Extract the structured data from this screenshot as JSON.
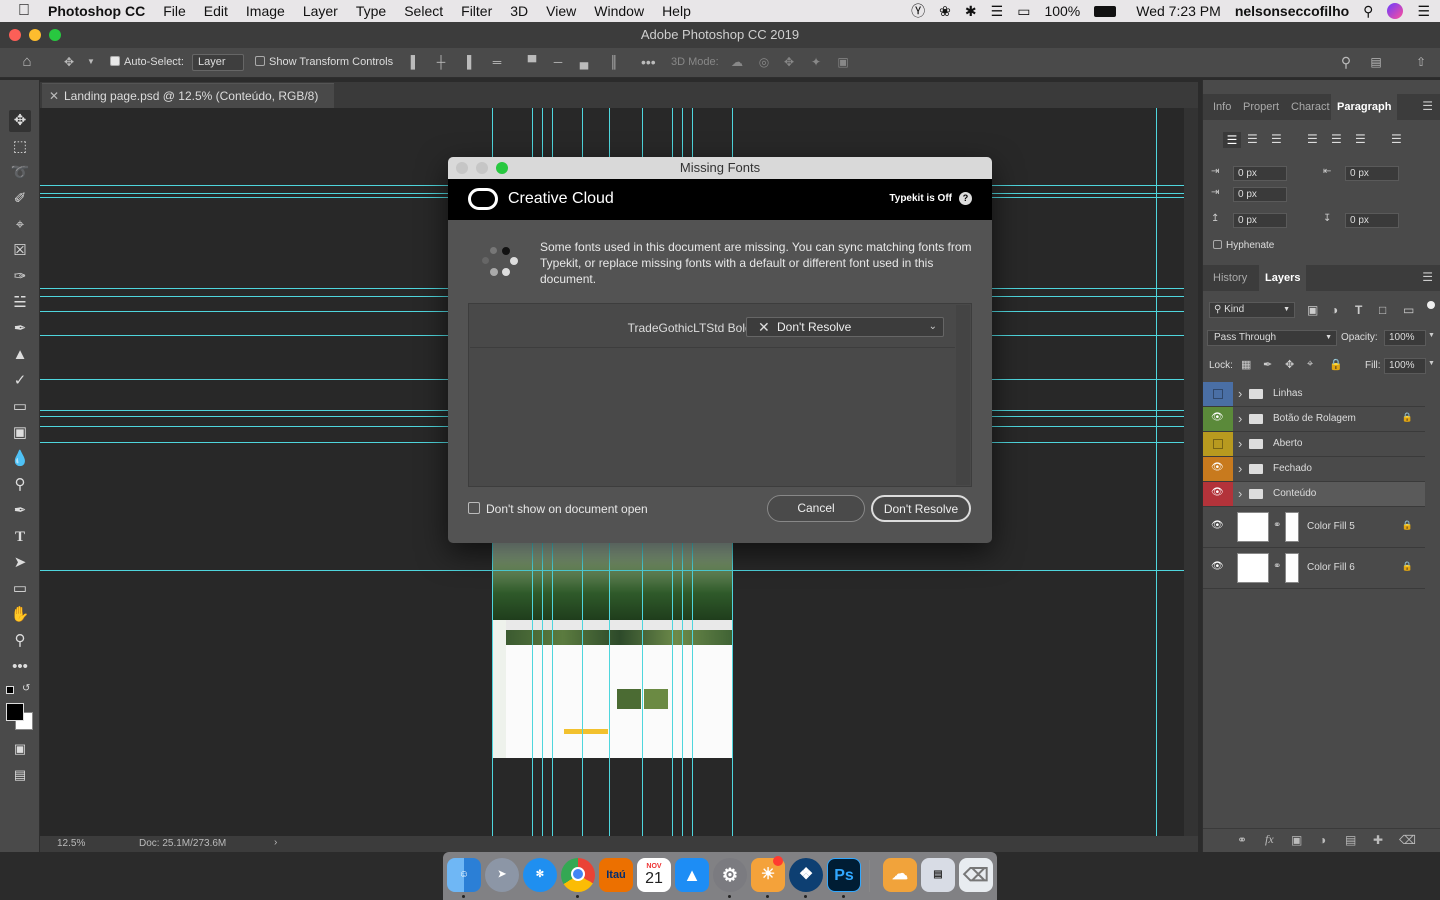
{
  "menubar": {
    "app": "Photoshop CC",
    "items": [
      "File",
      "Edit",
      "Image",
      "Layer",
      "Type",
      "Select",
      "Filter",
      "3D",
      "View",
      "Window",
      "Help"
    ],
    "battery": "100%",
    "datetime": "Wed 7:23 PM",
    "user": "nelsonseccofilho"
  },
  "window": {
    "title": "Adobe Photoshop CC 2019"
  },
  "options": {
    "auto_select_label": "Auto-Select:",
    "auto_select_value": "Layer",
    "show_transform_label": "Show Transform Controls",
    "mode_3d_label": "3D Mode:"
  },
  "document": {
    "tab_title": "Landing page.psd @ 12.5% (Conteúdo, RGB/8)"
  },
  "status": {
    "zoom": "12.5%",
    "doc_info": "Doc: 25.1M/273.6M"
  },
  "paragraph_panel": {
    "tabs": [
      "Info",
      "Propert",
      "Charact",
      "Paragraph"
    ],
    "fields": {
      "indent_left": "0 px",
      "indent_right": "0 px",
      "indent_first": "0 px",
      "space_before": "0 px",
      "space_after": "0 px"
    },
    "hyphenate_label": "Hyphenate"
  },
  "layers_panel": {
    "tabs": [
      "History",
      "Layers"
    ],
    "filter_kind": "Kind",
    "blend_mode": "Pass Through",
    "opacity_label": "Opacity:",
    "opacity_value": "100%",
    "lock_label": "Lock:",
    "fill_label": "Fill:",
    "fill_value": "100%",
    "layers": [
      {
        "name": "Linhas",
        "color": "#4a6fa5",
        "visible": false,
        "locked": false
      },
      {
        "name": "Botão de Rolagem",
        "color": "#5b8a3a",
        "visible": true,
        "locked": true
      },
      {
        "name": "Aberto",
        "color": "#b89a1f",
        "visible": false,
        "locked": false
      },
      {
        "name": "Fechado",
        "color": "#c87a1e",
        "visible": true,
        "locked": false
      },
      {
        "name": "Conteúdo",
        "color": "#b3333a",
        "visible": true,
        "locked": false,
        "selected": true
      },
      {
        "name": "Color Fill 5",
        "visible": true,
        "locked": true
      },
      {
        "name": "Color Fill 6",
        "visible": true,
        "locked": true
      }
    ]
  },
  "dialog": {
    "title": "Missing Fonts",
    "brand": "Creative Cloud",
    "typekit_status": "Typekit is Off",
    "message": "Some fonts used in this document are missing. You can sync matching fonts from Typekit, or replace missing fonts with a default or different font used in this document.",
    "missing_font": "TradeGothicLTStd Bold:",
    "resolution_value": "Don't Resolve",
    "dont_show_label": "Don't show on document open",
    "cancel_label": "Cancel",
    "confirm_label": "Don't Resolve"
  },
  "dock": {
    "itau": "Itaú",
    "calendar_month": "NOV",
    "calendar_day": "21",
    "ps": "Ps"
  },
  "colors": {
    "guide": "#4fd6dd",
    "accent": "#2d7cf6"
  }
}
